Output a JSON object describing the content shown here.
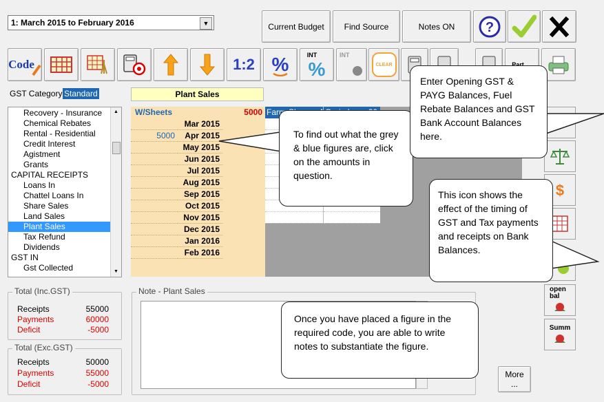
{
  "period": {
    "selected": "1: March 2015 to February 2016"
  },
  "top_buttons": {
    "current_budget": "Current Budget",
    "find_source": "Find Source",
    "notes": "Notes ON"
  },
  "toolbar": {
    "code_label": "Code",
    "half_label": "1:2",
    "int_label": "INT",
    "int2_label": "INT",
    "clear_label": "CLEAR",
    "part_label": "Part"
  },
  "gst_category": {
    "label": "GST Category",
    "value": "Standard"
  },
  "selected_code_title": "Plant Sales",
  "categories": [
    {
      "label": "Recovery - Insurance",
      "indent": true,
      "selected": false
    },
    {
      "label": "Chemical Rebates",
      "indent": true,
      "selected": false
    },
    {
      "label": "Rental - Residential",
      "indent": true,
      "selected": false
    },
    {
      "label": "Credit Interest",
      "indent": true,
      "selected": false
    },
    {
      "label": "Agistment",
      "indent": true,
      "selected": false
    },
    {
      "label": "Grants",
      "indent": true,
      "selected": false
    },
    {
      "label": "CAPITAL RECEIPTS",
      "indent": false,
      "selected": false
    },
    {
      "label": "Loans In",
      "indent": true,
      "selected": false
    },
    {
      "label": "Chattel Loans In",
      "indent": true,
      "selected": false
    },
    {
      "label": "Share Sales",
      "indent": true,
      "selected": false
    },
    {
      "label": "Land Sales",
      "indent": true,
      "selected": false
    },
    {
      "label": "Plant Sales",
      "indent": true,
      "selected": true
    },
    {
      "label": "Tax Refund",
      "indent": true,
      "selected": false
    },
    {
      "label": "Dividends",
      "indent": true,
      "selected": false
    },
    {
      "label": "GST IN",
      "indent": false,
      "selected": false
    },
    {
      "label": "Gst Collected",
      "indent": true,
      "selected": false
    }
  ],
  "grid": {
    "wsheets_label": "W/Sheets",
    "wsheets_value": "5000",
    "col_headers": [
      "Farm Cheque A",
      "Grain Loan 20"
    ],
    "months": [
      "Mar 2015",
      "Apr 2015",
      "May 2015",
      "Jun 2015",
      "Jul 2015",
      "Aug 2015",
      "Sep 2015",
      "Oct 2015",
      "Nov 2015",
      "Dec 2015",
      "Jan 2016",
      "Feb 2016"
    ],
    "values": [
      "",
      "5000",
      "",
      "",
      "",
      "",
      "",
      "",
      "",
      "",
      "",
      ""
    ]
  },
  "totals_inc": {
    "title": "Total (Inc.GST)",
    "receipts_label": "Receipts",
    "receipts": "55000",
    "payments_label": "Payments",
    "payments": "60000",
    "deficit_label": "Deficit",
    "deficit": "-5000"
  },
  "totals_exc": {
    "title": "Total (Exc.GST)",
    "receipts_label": "Receipts",
    "receipts": "50000",
    "payments_label": "Payments",
    "payments": "55000",
    "deficit_label": "Deficit",
    "deficit": "-5000"
  },
  "note": {
    "title": "Note - Plant Sales",
    "text": ""
  },
  "side_buttons": {
    "open_bal": "open bal",
    "summ": "Summ"
  },
  "more_button": "More ...",
  "callouts": {
    "grid_help": "To find out what the grey & blue figures are, click on the amounts in question.",
    "opening_balances": "Enter Opening GST & PAYG Balances, Fuel Rebate Balances and GST Bank Account Balances here.",
    "timing_icon": "This icon shows the effect of the timing of GST and Tax payments and receipts on Bank Balances.",
    "notes_help": "Once you have placed a figure in the required code, you are able to write notes to substantiate the figure."
  },
  "colors": {
    "grid_tan": "#fae2b5",
    "grid_header_blue": "#1f66b3",
    "selection_blue": "#3399ff",
    "negative_red": "#e00000"
  }
}
